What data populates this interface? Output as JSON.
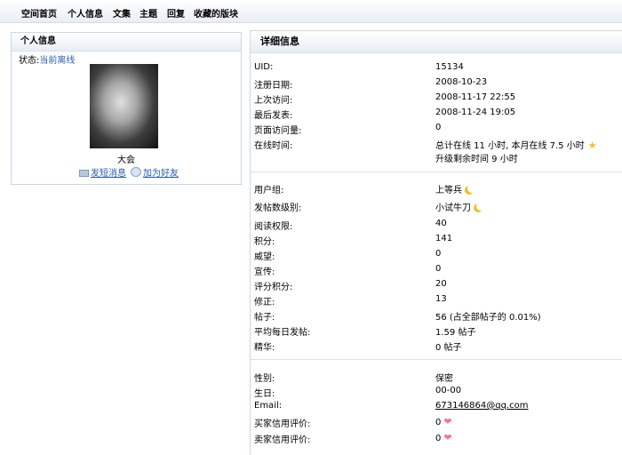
{
  "nav": [
    "空间首页",
    "个人信息",
    "文集",
    "主题",
    "回复",
    "收藏的版块"
  ],
  "left_panel": {
    "title": "个人信息",
    "status_label": "状态:",
    "status_value": "当前离线",
    "username": "大会",
    "send_message": "发短消息",
    "add_friend": "加为好友"
  },
  "detail": {
    "title": "详细信息",
    "uid_label": "UID:",
    "uid": "15134",
    "reg_label": "注册日期:",
    "reg": "2008-10-23",
    "last_visit_label": "上次访问:",
    "last_visit": "2008-11-17 22:55",
    "last_post_label": "最后发表:",
    "last_post": "2008-11-24 19:05",
    "page_views_label": "页面访问量:",
    "page_views": "0",
    "online_label": "在线时间:",
    "online_line1": "总计在线 11 小时, 本月在线 7.5 小时",
    "online_line2": "升级剩余时间 9 小时",
    "group_label": "用户组:",
    "group": "上等兵",
    "post_level_label": "发帖数级别:",
    "post_level": "小试牛刀",
    "read_perm_label": "阅读权限:",
    "read_perm": "40",
    "points_label": "积分:",
    "points": "141",
    "prestige_label": "威望:",
    "prestige": "0",
    "promo_label": "宣传:",
    "promo": "0",
    "rating_label": "评分积分:",
    "rating": "20",
    "adjust_label": "修正:",
    "adjust": "13",
    "posts_label": "帖子:",
    "posts": "56 (占全部帖子的 0.01%)",
    "avg_label": "平均每日发帖:",
    "avg": "1.59 帖子",
    "digest_label": "精华:",
    "digest": "0 帖子",
    "gender_label": "性别:",
    "gender": "保密",
    "birthday_label": "生日:",
    "birthday": "00-00",
    "email_label": "Email:",
    "email": "673146864@qq.com",
    "buyer_label": "买家信用评价:",
    "buyer": "0",
    "seller_label": "卖家信用评价:",
    "seller": "0"
  }
}
